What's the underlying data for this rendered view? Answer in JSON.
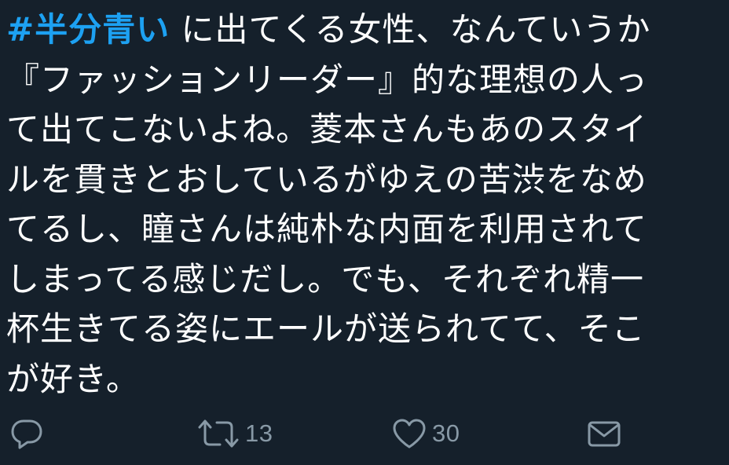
{
  "tweet": {
    "hashtag": "#半分青い",
    "lines": [
      " に出てくる女性、なんていうか",
      "『ファッションリーダー』的な理想の人っ",
      "て出てこないよね。菱本さんもあのスタイ",
      "ルを貫きとおしているがゆえの苦渋をなめ",
      "てるし、瞳さんは純朴な内面を利用されて",
      "しまってる感じだし。でも、それぞれ精一",
      "杯生きてる姿にエールが送られてて、そこ",
      "が好き。"
    ]
  },
  "actions": {
    "reply": {
      "icon": "reply-icon",
      "count": ""
    },
    "retweet": {
      "icon": "retweet-icon",
      "count": "13"
    },
    "like": {
      "icon": "heart-icon",
      "count": "30"
    },
    "dm": {
      "icon": "envelope-icon",
      "count": ""
    }
  },
  "colors": {
    "background": "#15202b",
    "text": "#ffffff",
    "hashtag": "#1da1f2",
    "icon": "#8899a6"
  }
}
